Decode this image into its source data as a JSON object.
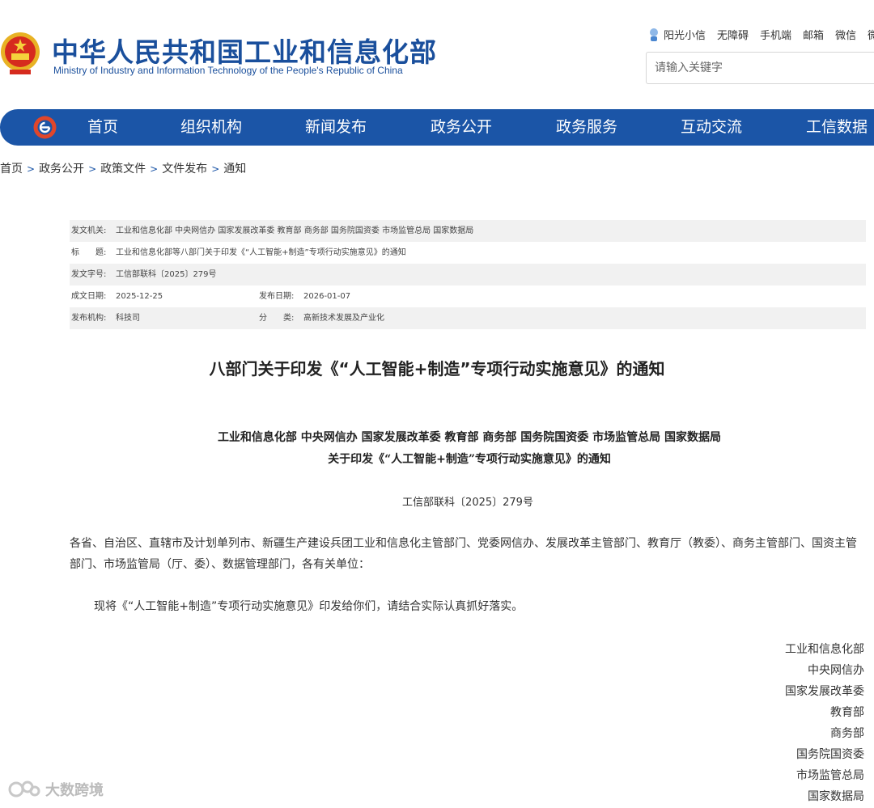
{
  "header": {
    "title": "中华人民共和国工业和信息化部",
    "subtitle": "Ministry of Industry and Information Technology of the People's Republic of China",
    "top_links": [
      "阳光小信",
      "无障碍",
      "手机端",
      "邮箱",
      "微信",
      "微"
    ],
    "search_placeholder": "请输入关键字"
  },
  "nav": {
    "items": [
      "首页",
      "组织机构",
      "新闻发布",
      "政务公开",
      "政务服务",
      "互动交流",
      "工信数据"
    ]
  },
  "breadcrumb": [
    "首页",
    "政务公开",
    "政策文件",
    "文件发布",
    "通知"
  ],
  "breadcrumb_sep": ">",
  "info": {
    "issuer_label": "发文机关:",
    "issuer_value": "工业和信息化部 中央网信办 国家发展改革委 教育部 商务部 国务院国资委 市场监管总局 国家数据局",
    "title_label": "标　　题:",
    "title_value": "工业和信息化部等八部门关于印发《“人工智能+制造”专项行动实施意见》的通知",
    "docno_label": "发文字号:",
    "docno_value": "工信部联科〔2025〕279号",
    "created_label": "成文日期:",
    "created_value": "2025-12-25",
    "published_label": "发布日期:",
    "published_value": "2026-01-07",
    "org_label": "发布机构:",
    "org_value": "科技司",
    "category_label": "分　　类:",
    "category_value": "高新技术发展及产业化"
  },
  "doc": {
    "title": "八部门关于印发《“人工智能+制造”专项行动实施意见》的通知",
    "issuer_line1": "工业和信息化部  中央网信办  国家发展改革委  教育部  商务部  国务院国资委  市场监管总局  国家数据局",
    "issuer_line2": "关于印发《“人工智能+制造”专项行动实施意见》的通知",
    "number": "工信部联科〔2025〕279号",
    "para1": "各省、自治区、直辖市及计划单列市、新疆生产建设兵团工业和信息化主管部门、党委网信办、发展改革主管部门、教育厅（教委）、商务主管部门、国资主管部门、市场监管局（厅、委）、数据管理部门，各有关单位：",
    "para2": "现将《“人工智能+制造”专项行动实施意见》印发给你们，请结合实际认真抓好落实。",
    "signers": [
      "工业和信息化部",
      "中央网信办",
      "国家发展改革委",
      "教育部",
      "商务部",
      "国务院国资委",
      "市场监管总局",
      "国家数据局"
    ]
  },
  "watermark": "大数跨境",
  "colors": {
    "brand": "#1b55a7",
    "title": "#1a4f9c"
  }
}
